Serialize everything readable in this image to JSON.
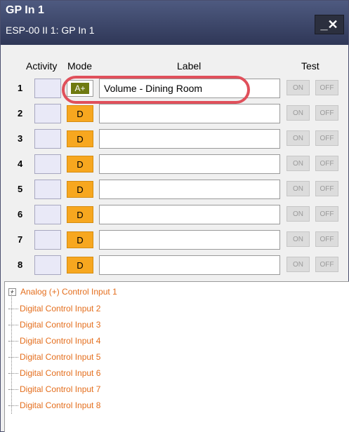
{
  "window": {
    "title": "GP In 1",
    "subtitle": "ESP-00 II 1: GP In 1",
    "close_icon": "minimize-close-icon"
  },
  "headers": {
    "activity": "Activity",
    "mode": "Mode",
    "label": "Label",
    "test": "Test"
  },
  "rows": [
    {
      "num": "1",
      "mode": "A+",
      "label": "Volume - Dining Room",
      "on": "ON",
      "off": "OFF"
    },
    {
      "num": "2",
      "mode": "D",
      "label": "",
      "on": "ON",
      "off": "OFF"
    },
    {
      "num": "3",
      "mode": "D",
      "label": "",
      "on": "ON",
      "off": "OFF"
    },
    {
      "num": "4",
      "mode": "D",
      "label": "",
      "on": "ON",
      "off": "OFF"
    },
    {
      "num": "5",
      "mode": "D",
      "label": "",
      "on": "ON",
      "off": "OFF"
    },
    {
      "num": "6",
      "mode": "D",
      "label": "",
      "on": "ON",
      "off": "OFF"
    },
    {
      "num": "7",
      "mode": "D",
      "label": "",
      "on": "ON",
      "off": "OFF"
    },
    {
      "num": "8",
      "mode": "D",
      "label": "",
      "on": "ON",
      "off": "OFF"
    }
  ],
  "tree": {
    "items": [
      "Analog (+) Control Input 1",
      "Digital Control Input 2",
      "Digital Control Input 3",
      "Digital Control Input 4",
      "Digital Control Input 5",
      "Digital Control Input 6",
      "Digital Control Input 7",
      "Digital Control Input 8"
    ]
  },
  "colors": {
    "titlebar": "#3a4468",
    "mode_d": "#f7a71f",
    "mode_a": "#6f7a10",
    "tree_text": "#e46e1d",
    "highlight": "#e0505b"
  }
}
